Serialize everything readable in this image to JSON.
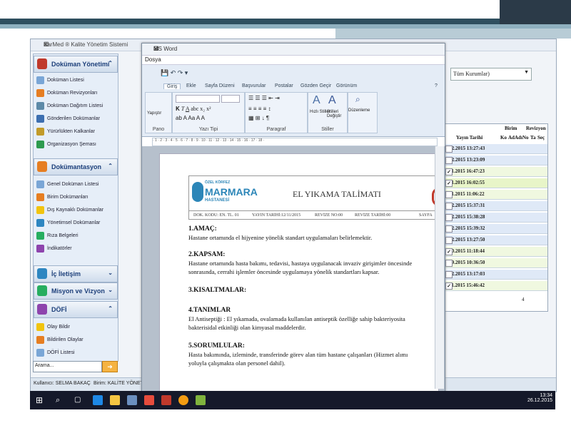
{
  "back_app": {
    "title": "KarMed ® Kalite Yönetim Sistemi",
    "combo_value": "Tüm Kurumlar)",
    "search_placeholder": "Arama...",
    "status_user": "Kullanıcı: SELMA BAKAÇ",
    "status_unit": "Birim: KALİTE YÖNET",
    "sidebar": {
      "groups": [
        {
          "label": "Doküman Yönetimi",
          "color": "#c0392b"
        },
        {
          "label": "Dokümantasyon",
          "color": "#e67e22"
        },
        {
          "label": "İç İletişim",
          "color": "#2e86c1"
        },
        {
          "label": "Misyon ve Vizyon",
          "color": "#27ae60"
        },
        {
          "label": "DÖFİ",
          "color": "#8e44ad"
        }
      ],
      "items_group1": [
        "Doküman Listesi",
        "Doküman Revizyonları",
        "Doküman Dağıtım Listesi",
        "Gönderilen Dokümanlar",
        "Yürürlükten Kalkanlar",
        "Organizasyon Şeması"
      ],
      "items_group2": [
        "Genel Doküman Listesi",
        "Birim Dokümanları",
        "Dış Kaynaklı Dokümanlar",
        "Yönetimsel Dokümanlar",
        "Rıza Belgeleri",
        "İndikatörler"
      ],
      "items_group5": [
        "Olay Bildir",
        "Bildirilen Olaylar",
        "DÖFİ Listesi"
      ]
    },
    "grid": {
      "group_headers": [
        "Birim",
        "Revizyon"
      ],
      "columns": [
        "Yayın Tarihi",
        "Ko",
        "Ad",
        "Adı",
        "No",
        "Ta",
        "Seç"
      ],
      "rows": [
        {
          "date": "2.12.2015 13:27:43",
          "checked": false,
          "bg": "#dfe9f7"
        },
        {
          "date": "2.12.2015 13:23:09",
          "checked": false,
          "bg": "#dfe9f7"
        },
        {
          "date": "6.11.2015 16:47:23",
          "checked": true,
          "bg": "#f0f8e0"
        },
        {
          "date": "2.11.2015 16:02:55",
          "checked": true,
          "bg": "#e8f5c8"
        },
        {
          "date": "2.11.2015 11:06:22",
          "checked": false,
          "bg": "#f0f8e0"
        },
        {
          "date": "2.12.2015 15:37:31",
          "checked": false,
          "bg": "#dfe9f7"
        },
        {
          "date": "2.12.2015 15:38:28",
          "checked": false,
          "bg": "#dfe9f7"
        },
        {
          "date": "2.12.2015 15:39:32",
          "checked": false,
          "bg": "#dfe9f7"
        },
        {
          "date": "2.12.2015 13:27:50",
          "checked": false,
          "bg": "#dfe9f7"
        },
        {
          "date": "1.10.2015 11:18:44",
          "checked": true,
          "bg": "#f0f8e0"
        },
        {
          "date": "6.09.2015 10:36:50",
          "checked": false,
          "bg": "#f0f8e0"
        },
        {
          "date": "6.12.2015 13:17:03",
          "checked": false,
          "bg": "#dfe9f7"
        },
        {
          "date": "0.11.2015 15:46:42",
          "checked": true,
          "bg": "#f0f8e0"
        }
      ],
      "footer_count": "4"
    }
  },
  "word": {
    "title": "MS Word",
    "menu": "Dosya",
    "tabs": [
      "Giriş",
      "Ekle",
      "Sayfa Düzeni",
      "Başvurular",
      "Postalar",
      "Gözden Geçir",
      "Görünüm"
    ],
    "groups": [
      "Pano",
      "Yazı Tipi",
      "Paragraf",
      "Stiller",
      "Düzenleme"
    ],
    "paste_label": "Yapıştır",
    "style_labels": [
      "Hızlı Stiller",
      "Stilleri Değiştir"
    ],
    "doc": {
      "logo_top": "ÖZEL KÖRFEZ",
      "logo_name": "MARMARA",
      "logo_sub": "HASTANESİ",
      "title": "EL YIKAMA TALİMATI",
      "meta": [
        "DOK. KODU: EN. TL. 01",
        "YAYIN TARİHİ:12/11/2015",
        "REVİZE NO:00",
        "REVİZE TARİHİ:00",
        "SAYFA"
      ],
      "sections": [
        {
          "heading": "1.AMAÇ:",
          "lines": [
            "Hastane ortamında el hijyenine yönelik standart uygulamaları belirlemektir."
          ]
        },
        {
          "heading": "2.KAPSAM:",
          "lines": [
            "Hastane ortamında hasta bakımı, tedavisi, hastaya uygulanacak invaziv girişimler öncesinde",
            "sonrasında, cerrahi işlemler öncesinde uygulamaya yönelik standartları kapsar."
          ]
        },
        {
          "heading": "3.KISALTMALAR:",
          "lines": []
        },
        {
          "heading": "4.TANIMLAR",
          "lines": [
            "El Antiseptiği : El yıkamada, ovalamada kullanılan antiseptik özelliğe sahip bakteriyosita",
            "bakterisidal etkinliği olan kimyasal maddelerdir."
          ]
        },
        {
          "heading": "5.SORUMLULAR:",
          "lines": [
            "Hasta bakımında, izleminde, transferinde görev alan tüm hastane çalışanları (Hizmet alımı",
            "yoluyla çalışmakta olan personel dahil)."
          ]
        }
      ]
    }
  },
  "taskbar": {
    "time": "13:34",
    "date": "26.12.2015"
  }
}
